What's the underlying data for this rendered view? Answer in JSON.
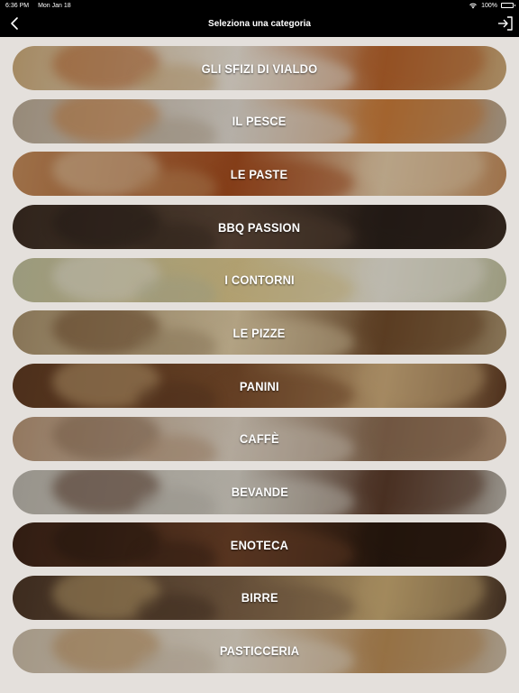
{
  "statusbar": {
    "time": "6:36 PM",
    "date": "Mon Jan 18",
    "battery": "100%",
    "battery_level": 1.0,
    "wifi_icon": "wifi-icon"
  },
  "navbar": {
    "title": "Seleziona una categoria",
    "back_icon": "chevron-left-icon",
    "logout_icon": "logout-icon"
  },
  "categories": [
    {
      "label": "GLI SFIZI DI VIALDO",
      "colors": [
        "#c9a878",
        "#e8e0d4",
        "#b5632c"
      ]
    },
    {
      "label": "IL PESCE",
      "colors": [
        "#b8a893",
        "#ddd6cc",
        "#c77b3a"
      ]
    },
    {
      "label": "LE PASTE",
      "colors": [
        "#c08a5a",
        "#a24c1f",
        "#e0c7a4"
      ]
    },
    {
      "label": "BBQ PASSION",
      "colors": [
        "#3a2c22",
        "#5a4536",
        "#2a201a"
      ]
    },
    {
      "label": "I CONTORNI",
      "colors": [
        "#bdbc9a",
        "#d8c48a",
        "#e6e2d4"
      ]
    },
    {
      "label": "LE PIZZE",
      "colors": [
        "#a58e6a",
        "#d9c6a0",
        "#6f4b2b"
      ]
    },
    {
      "label": "PANINI",
      "colors": [
        "#5e3a22",
        "#7a4d2c",
        "#c9a878"
      ]
    },
    {
      "label": "CAFFÈ",
      "colors": [
        "#b39274",
        "#d9cdbd",
        "#8a6b51"
      ]
    },
    {
      "label": "BEVANDE",
      "colors": [
        "#b9b4aa",
        "#d4cfc4",
        "#5a3b2a"
      ]
    },
    {
      "label": "ENOTECA",
      "colors": [
        "#3b2317",
        "#6b4128",
        "#2a1a10"
      ]
    },
    {
      "label": "BIRRE",
      "colors": [
        "#4a3526",
        "#7a5f45",
        "#c6a872"
      ]
    },
    {
      "label": "PASTICCERIA",
      "colors": [
        "#c8b9a4",
        "#e2d8c8",
        "#b78a55"
      ]
    }
  ]
}
